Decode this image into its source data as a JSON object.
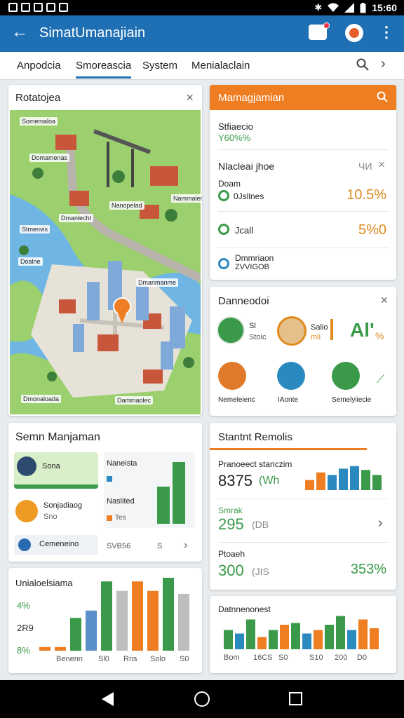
{
  "status_bar": {
    "time": "15:60"
  },
  "app_bar": {
    "back_label": "←",
    "title": "SimatUmanajiain",
    "menu_label": "⋮"
  },
  "tabs": [
    "Anpodcia",
    "Smoreascia",
    "System",
    "Menialaclain"
  ],
  "tab_next": "›",
  "map_card": {
    "title": "Rotatojea",
    "close": "×",
    "labels": [
      "Somemaloa",
      "Domamenas",
      "Nanopelad",
      "Nammaler",
      "Dmanlecht",
      "Stmenvis",
      "Doalne",
      "Dmanmanme",
      "Dammaolec",
      "Dmonaloada"
    ]
  },
  "mgmt_card": {
    "title": "Mamagjamian",
    "row1": {
      "label": "Stfiaecio",
      "value": "Y60%%"
    },
    "row2": {
      "label": "Nlacleai jhoe",
      "meta": "ЧИ",
      "close": "×"
    },
    "row3": {
      "label": "Doam",
      "sub": "0Jsllnes",
      "value": "10.5%"
    },
    "row4": {
      "label": "Jcall",
      "value": "5%0"
    },
    "row5": {
      "label": "Dmmriaon",
      "sub": "ZVVIGOB"
    },
    "accent": "#ef7d22",
    "value_color": "#e08a1e"
  },
  "dash_card": {
    "title": "Danneodoi",
    "close": "×",
    "item1_label": "Sl",
    "item1_sub": "Stoic",
    "item2_label": "Salio",
    "item2_sub": "mil",
    "big_value": "Al'",
    "big_suffix": "%",
    "icons": [
      {
        "label": "Nemeleienc",
        "color": "#e07a2a"
      },
      {
        "label": "IAonte",
        "color": "#2a8ac0"
      },
      {
        "label": "Semelyiiecie",
        "color": "#3a9a4a"
      }
    ],
    "arrow": "⟋"
  },
  "sem_card": {
    "title": "Semn Manjaman",
    "item1": "Sona",
    "item2_label": "Sonjadiaog",
    "item2_sub": "Sno",
    "item3": "Cemeneino",
    "legend1": "Naneista",
    "legend2": "Naslited",
    "legend2_sub": "Tes",
    "foot_value": "SVB56",
    "foot_unit": "S",
    "chevron": "›",
    "bar_fracs": [
      0.55,
      0.92
    ]
  },
  "stats_card": {
    "title": "Stantnt Remolis",
    "row1": {
      "label": "Pranoeect stanczim",
      "value": "8375",
      "suffix": "(Wh"
    },
    "row2": {
      "label": "Smrak",
      "value": "295",
      "suffix": "(DB"
    },
    "row3": {
      "label": "Ptoaeh",
      "value": "300",
      "suffix": "(JIS",
      "right": "353%"
    },
    "chevron": "›",
    "mini_bars": [
      {
        "value": 0.4,
        "color": "#ef7d22"
      },
      {
        "value": 0.7,
        "color": "#ef7d22"
      },
      {
        "value": 0.6,
        "color": "#2a8ac0"
      },
      {
        "value": 0.85,
        "color": "#2a8ac0"
      },
      {
        "value": 0.95,
        "color": "#2a8ac0"
      },
      {
        "value": 0.8,
        "color": "#3a9a4a"
      },
      {
        "value": 0.6,
        "color": "#3a9a4a"
      }
    ]
  },
  "chart1": {
    "title": "Unialoelsiama",
    "y_labels": [
      "4%",
      "2R9",
      "8%"
    ],
    "x_labels": [
      "Benenn",
      "Sl0",
      "Rns",
      "Solo",
      "S0"
    ],
    "bars": [
      {
        "value": 0.05,
        "color": "#ef7d22"
      },
      {
        "value": 0.05,
        "color": "#ef7d22"
      },
      {
        "value": 0.45,
        "color": "#3a9a4a"
      },
      {
        "value": 0.55,
        "color": "#5b8fc9"
      },
      {
        "value": 0.95,
        "color": "#3a9a4a"
      },
      {
        "value": 0.82,
        "color": "#bdbdbd"
      },
      {
        "value": 0.95,
        "color": "#ef7d22"
      },
      {
        "value": 0.82,
        "color": "#ef7d22"
      },
      {
        "value": 1.0,
        "color": "#3a9a4a"
      },
      {
        "value": 0.78,
        "color": "#bdbdbd"
      }
    ]
  },
  "chart2": {
    "title": "Datnnenonest",
    "x_labels": [
      "Bom",
      "16CS",
      "S0",
      "S10",
      "200",
      "D0"
    ],
    "bars": [
      {
        "value": 0.55,
        "color": "#3a9a4a"
      },
      {
        "value": 0.45,
        "color": "#2a8ac0"
      },
      {
        "value": 0.85,
        "color": "#3a9a4a"
      },
      {
        "value": 0.35,
        "color": "#ef7d22"
      },
      {
        "value": 0.55,
        "color": "#3a9a4a"
      },
      {
        "value": 0.7,
        "color": "#ef7d22"
      },
      {
        "value": 0.75,
        "color": "#3a9a4a"
      },
      {
        "value": 0.45,
        "color": "#2a8ac0"
      },
      {
        "value": 0.55,
        "color": "#ef7d22"
      },
      {
        "value": 0.7,
        "color": "#3a9a4a"
      },
      {
        "value": 0.95,
        "color": "#3a9a4a"
      },
      {
        "value": 0.55,
        "color": "#2a8ac0"
      },
      {
        "value": 0.85,
        "color": "#ef7d22"
      },
      {
        "value": 0.6,
        "color": "#ef7d22"
      }
    ]
  }
}
